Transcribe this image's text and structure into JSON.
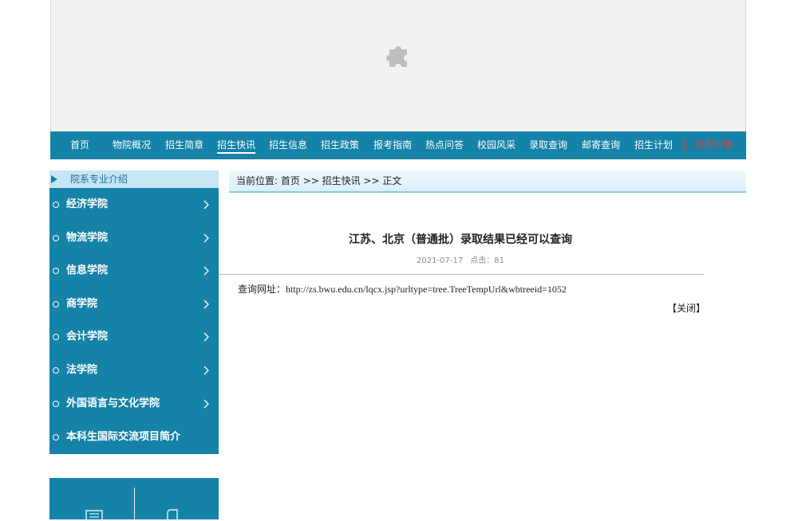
{
  "nav": {
    "items": [
      {
        "label": "首页"
      },
      {
        "label": "物院概况"
      },
      {
        "label": "招生简章"
      },
      {
        "label": "招生快讯"
      },
      {
        "label": "招生信息"
      },
      {
        "label": "招生政策"
      },
      {
        "label": "报考指南"
      },
      {
        "label": "热点问答"
      },
      {
        "label": "校园风采"
      },
      {
        "label": "录取查询"
      },
      {
        "label": "邮寄查询"
      },
      {
        "label": "招生计划"
      },
      {
        "label": "历年分数"
      }
    ],
    "active": "招生快讯"
  },
  "sidebar": {
    "heading": "院系专业介绍",
    "items": [
      {
        "label": "经济学院"
      },
      {
        "label": "物流学院"
      },
      {
        "label": "信息学院"
      },
      {
        "label": "商学院"
      },
      {
        "label": "会计学院"
      },
      {
        "label": "法学院"
      },
      {
        "label": "外国语言与文化学院"
      },
      {
        "label": "本科生国际交流项目简介"
      }
    ]
  },
  "breadcrumb": {
    "text": "当前位置: 首页 >> 招生快讯 >> 正文"
  },
  "article": {
    "title": "江苏、北京（普通批）录取结果已经可以查询",
    "date": "2021-07-17",
    "views_label": "点击：",
    "views": "81",
    "body_label": "查询网址：",
    "body_url": "http://zs.bwu.edu.cn/lqcx.jsp?urltype=tree.TreeTempUrl&wbtreeid=1052",
    "close_label": "【关闭】"
  },
  "colors": {
    "brand": "#1582a8",
    "highlight": "#e0433b"
  }
}
